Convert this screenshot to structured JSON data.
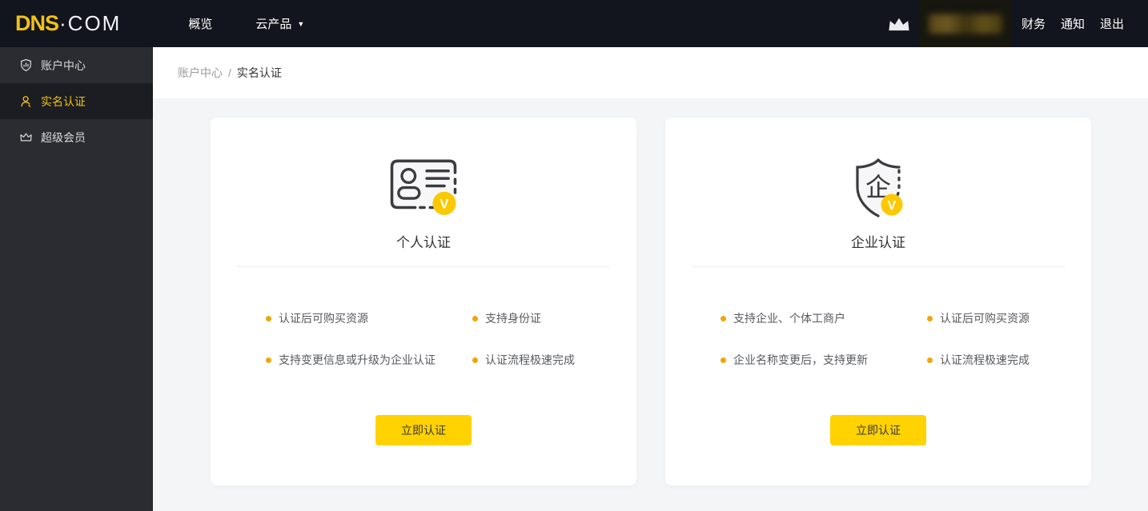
{
  "topbar": {
    "logo_primary": "DNS",
    "logo_secondary": "·COM",
    "nav": [
      {
        "label": "概览"
      },
      {
        "label": "云产品"
      }
    ],
    "dropdown_caret": "▼",
    "links": [
      {
        "label": "财务"
      },
      {
        "label": "通知"
      },
      {
        "label": "退出"
      }
    ]
  },
  "sidebar": {
    "items": [
      {
        "label": "账户中心",
        "icon": "shield-chart-icon",
        "active": false
      },
      {
        "label": "实名认证",
        "icon": "person-icon",
        "active": true
      },
      {
        "label": "超级会员",
        "icon": "crown-icon",
        "active": false
      }
    ]
  },
  "breadcrumb": {
    "parent": "账户中心",
    "separator": "/",
    "current": "实名认证"
  },
  "cards": [
    {
      "title": "个人认证",
      "icon": "id-card-v-icon",
      "badge": "V",
      "features": [
        "认证后可购买资源",
        "支持身份证",
        "支持变更信息或升级为企业认证",
        "认证流程极速完成"
      ],
      "button": "立即认证"
    },
    {
      "title": "企业认证",
      "icon": "shield-enterprise-v-icon",
      "icon_glyph": "企",
      "badge": "V",
      "features": [
        "支持企业、个体工商户",
        "认证后可购买资源",
        "企业名称变更后，支持更新",
        "认证流程极速完成"
      ],
      "button": "立即认证"
    }
  ],
  "colors": {
    "topbar_bg": "#12151d",
    "sidebar_bg": "#2b2c31",
    "sidebar_active_bg": "#1c1d22",
    "accent_yellow": "#ffd200",
    "badge_yellow": "#fcc802",
    "bullet_amber": "#f0a50a",
    "logo_yellow": "#f2c118",
    "content_bg": "#f4f5f7"
  }
}
